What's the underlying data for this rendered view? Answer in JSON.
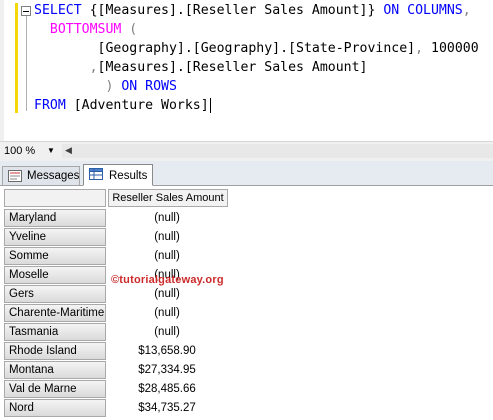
{
  "editor": {
    "lines": [
      [
        {
          "t": "SELECT ",
          "c": "kw"
        },
        {
          "t": "{[Measures].[Reseller Sales Amount]} ",
          "c": ""
        },
        {
          "t": "ON COLUMNS",
          "c": "kw"
        },
        {
          "t": ",",
          "c": "gray"
        }
      ],
      [
        {
          "t": "  ",
          "c": ""
        },
        {
          "t": "BOTTOMSUM",
          "c": "pink"
        },
        {
          "t": " (",
          "c": "gray"
        }
      ],
      [
        {
          "t": "        [Geography].[Geography].[State-Province]",
          "c": ""
        },
        {
          "t": ",",
          "c": "gray"
        },
        {
          "t": " 100000",
          "c": ""
        }
      ],
      [
        {
          "t": "       ",
          "c": ""
        },
        {
          "t": ",",
          "c": "gray"
        },
        {
          "t": "[Measures].[Reseller Sales Amount]",
          "c": ""
        }
      ],
      [
        {
          "t": "         ) ",
          "c": "gray"
        },
        {
          "t": "ON ROWS",
          "c": "kw"
        }
      ],
      [
        {
          "t": "FROM ",
          "c": "kw"
        },
        {
          "t": "[Adventure Works]",
          "c": ""
        }
      ]
    ]
  },
  "zoom": {
    "value": "100 %"
  },
  "tabs": {
    "messages": "Messages",
    "results": "Results"
  },
  "grid": {
    "column_header": "Reseller Sales Amount",
    "rows": [
      {
        "label": "Maryland",
        "value": "(null)"
      },
      {
        "label": "Yveline",
        "value": "(null)"
      },
      {
        "label": "Somme",
        "value": "(null)"
      },
      {
        "label": "Moselle",
        "value": "(null)"
      },
      {
        "label": "Gers",
        "value": "(null)"
      },
      {
        "label": "Charente-Maritime",
        "value": "(null)"
      },
      {
        "label": "Tasmania",
        "value": "(null)"
      },
      {
        "label": "Rhode Island",
        "value": "$13,658.90"
      },
      {
        "label": "Montana",
        "value": "$27,334.95"
      },
      {
        "label": "Val de Marne",
        "value": "$28,485.66"
      },
      {
        "label": "Nord",
        "value": "$34,735.27"
      }
    ]
  },
  "watermark": "©tutorialgateway.org",
  "colors": {
    "keyword": "#0000ff",
    "function": "#ff00ff",
    "operator": "#808080",
    "change_bar": "#f5d80c",
    "watermark": "#cc2a2a"
  }
}
